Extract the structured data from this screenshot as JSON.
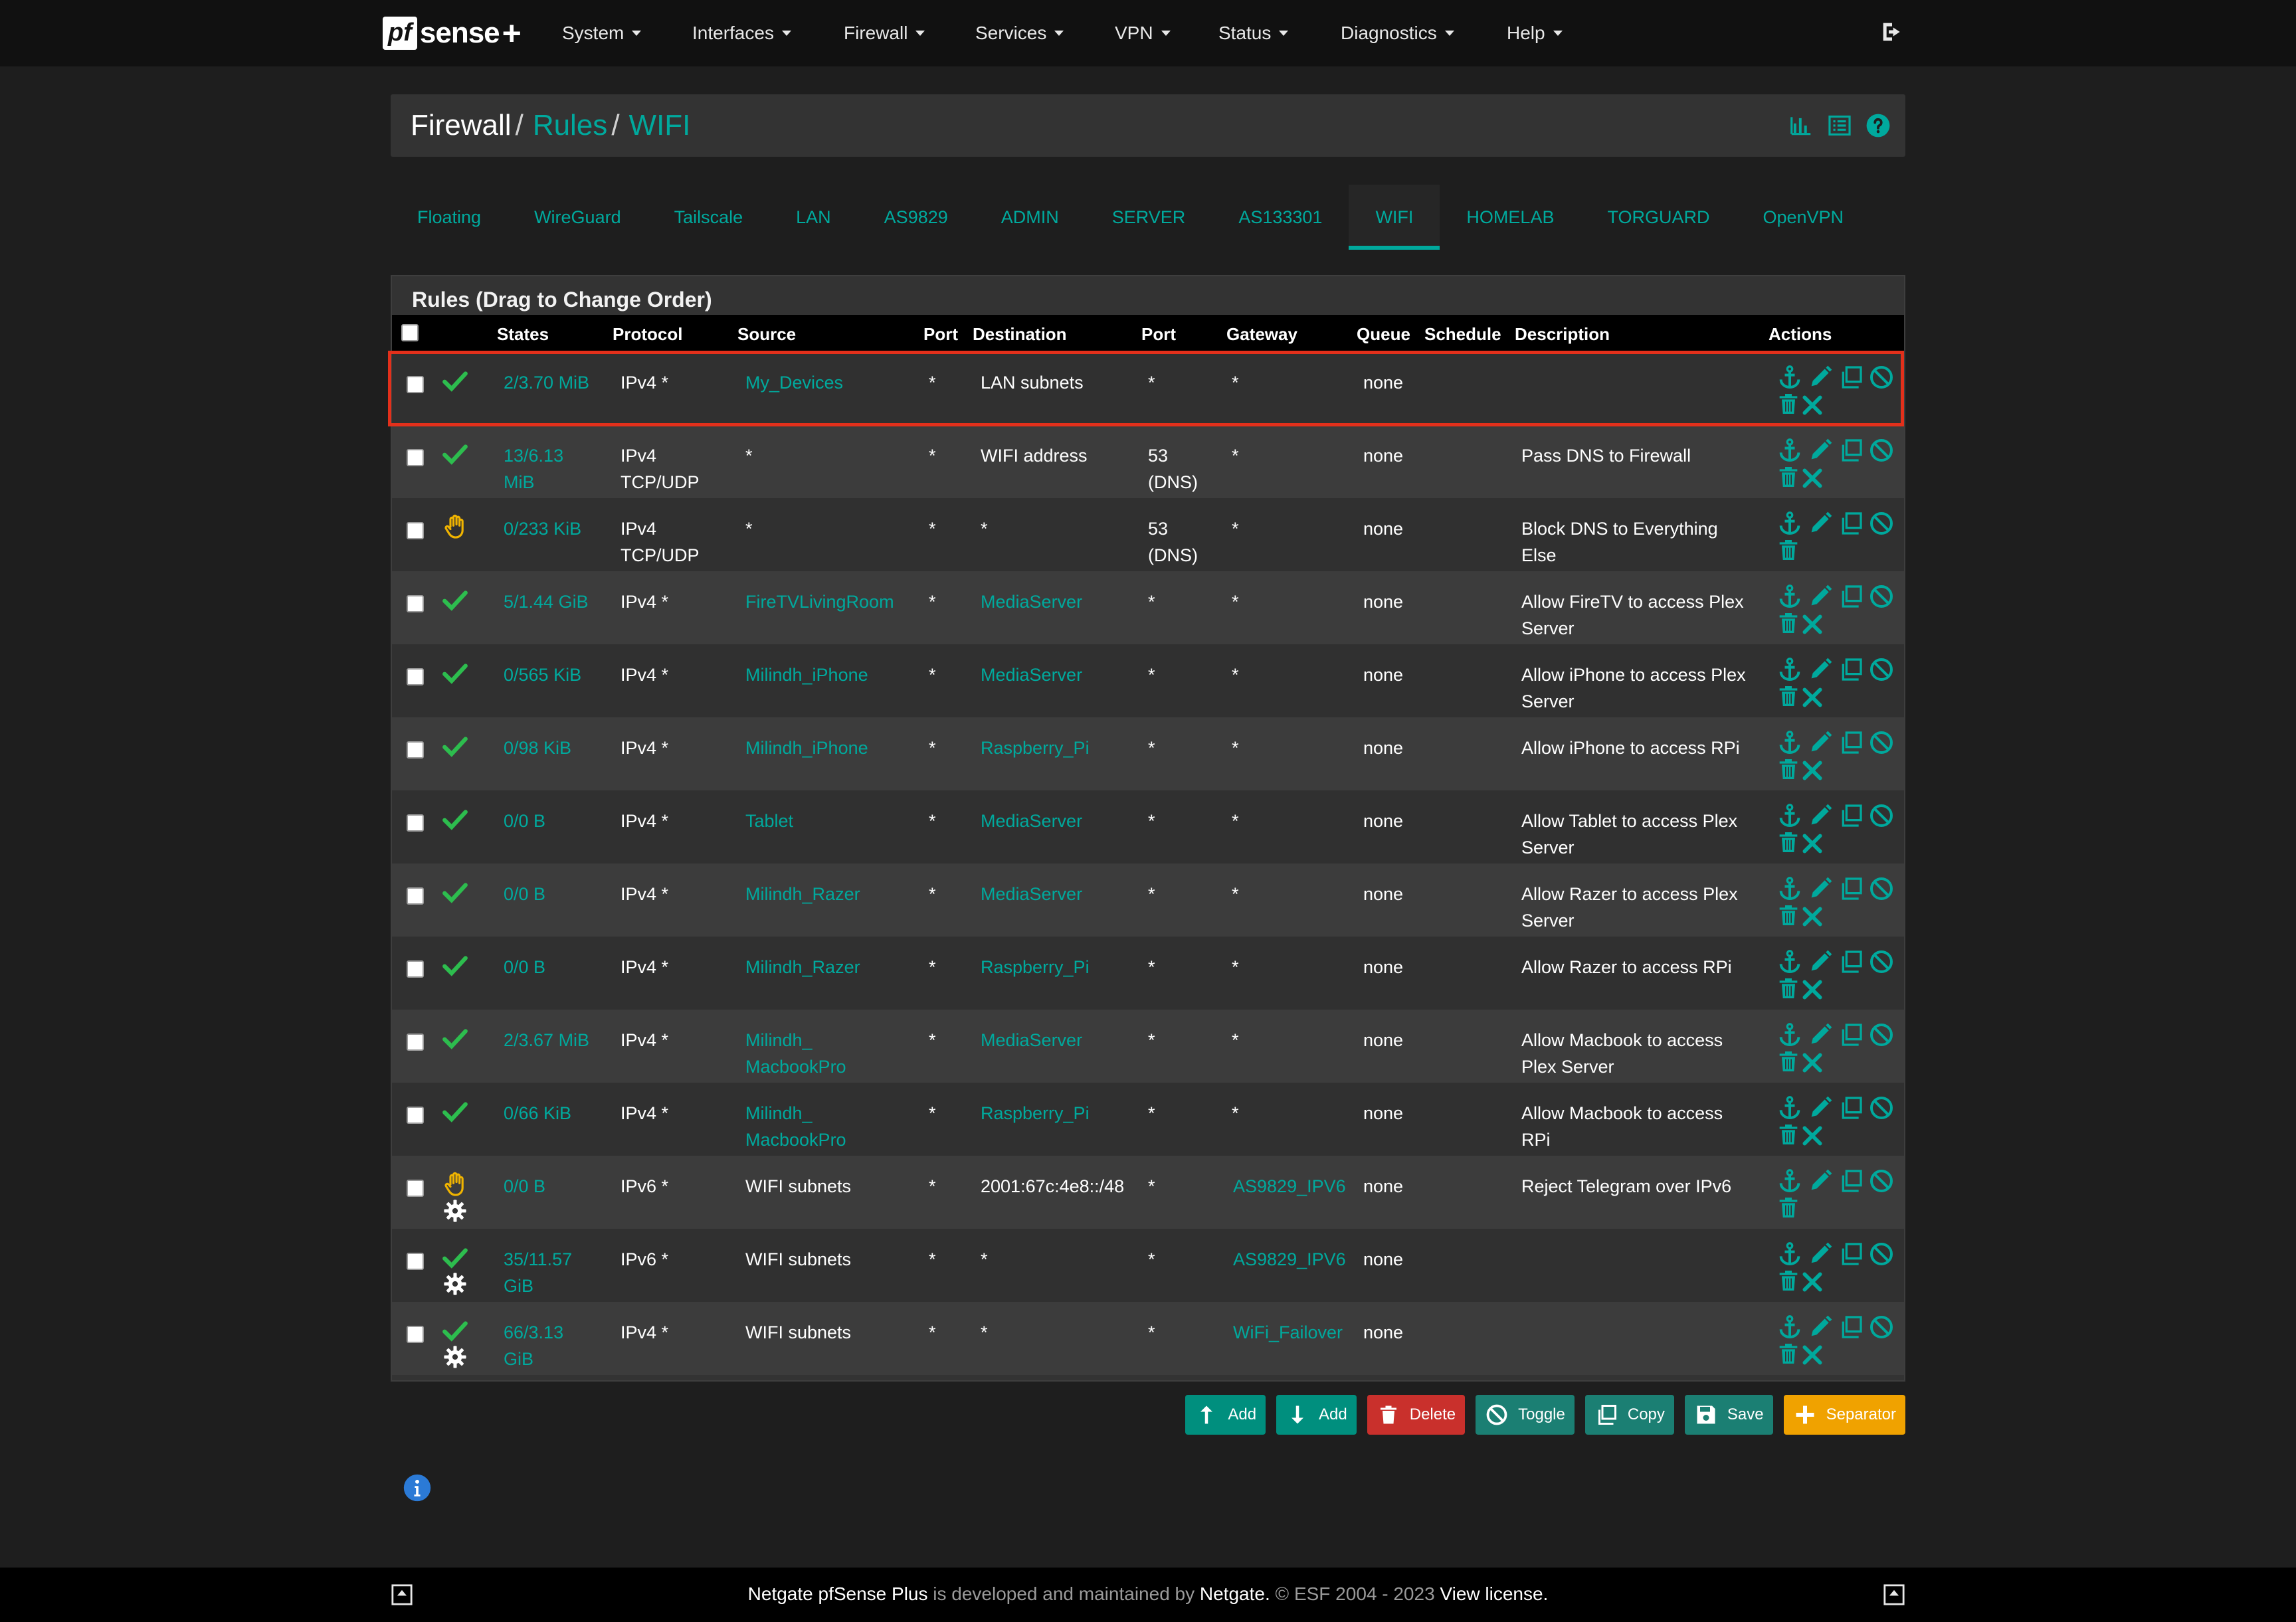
{
  "nav": {
    "brand_pf": "pf",
    "brand_sense": "sense",
    "brand_plus": "+",
    "menu": [
      "System",
      "Interfaces",
      "Firewall",
      "Services",
      "VPN",
      "Status",
      "Diagnostics",
      "Help"
    ]
  },
  "breadcrumb": {
    "part1": "Firewall",
    "sep1": "/",
    "part2": "Rules",
    "sep2": "/",
    "part3": "WIFI"
  },
  "tabs": [
    "Floating",
    "WireGuard",
    "Tailscale",
    "LAN",
    "AS9829",
    "ADMIN",
    "SERVER",
    "AS133301",
    "WIFI",
    "HOMELAB",
    "TORGUARD",
    "OpenVPN"
  ],
  "active_tab": "WIFI",
  "panel_title": "Rules (Drag to Change Order)",
  "columns": {
    "states": "States",
    "protocol": "Protocol",
    "source": "Source",
    "port": "Port",
    "destination": "Destination",
    "dport": "Port",
    "gateway": "Gateway",
    "queue": "Queue",
    "schedule": "Schedule",
    "description": "Description",
    "actions": "Actions"
  },
  "rules": [
    {
      "status": "pass",
      "gear": false,
      "states1": "2/3.70 MiB",
      "states2": "",
      "proto1": "IPv4 *",
      "proto2": "",
      "src1": "My_Devices",
      "src2": "",
      "src_link": true,
      "sport": "*",
      "dst": "LAN subnets",
      "dst_link": false,
      "dport1": "*",
      "dport2": "",
      "gw": "*",
      "gw_link": false,
      "queue": "none",
      "desc1": "",
      "desc2": "",
      "toggle_icon": true
    },
    {
      "status": "pass",
      "gear": false,
      "states1": "13/6.13",
      "states2": "MiB",
      "proto1": "IPv4",
      "proto2": "TCP/UDP",
      "src1": "*",
      "src2": "",
      "src_link": false,
      "sport": "*",
      "dst": "WIFI address",
      "dst_link": false,
      "dport1": "53",
      "dport2": "(DNS)",
      "gw": "*",
      "gw_link": false,
      "queue": "none",
      "desc1": "Pass DNS to Firewall",
      "desc2": "",
      "toggle_icon": true
    },
    {
      "status": "block",
      "gear": false,
      "states1": "0/233 KiB",
      "states2": "",
      "proto1": "IPv4",
      "proto2": "TCP/UDP",
      "src1": "*",
      "src2": "",
      "src_link": false,
      "sport": "*",
      "dst": "*",
      "dst_link": false,
      "dport1": "53",
      "dport2": "(DNS)",
      "gw": "*",
      "gw_link": false,
      "queue": "none",
      "desc1": "Block DNS to Everything",
      "desc2": "Else",
      "toggle_icon": false
    },
    {
      "status": "pass",
      "gear": false,
      "states1": "5/1.44 GiB",
      "states2": "",
      "proto1": "IPv4 *",
      "proto2": "",
      "src1": "FireTVLivingRoom",
      "src2": "",
      "src_link": true,
      "sport": "*",
      "dst": "MediaServer",
      "dst_link": true,
      "dport1": "*",
      "dport2": "",
      "gw": "*",
      "gw_link": false,
      "queue": "none",
      "desc1": "Allow FireTV to access Plex",
      "desc2": "Server",
      "toggle_icon": true
    },
    {
      "status": "pass",
      "gear": false,
      "states1": "0/565 KiB",
      "states2": "",
      "proto1": "IPv4 *",
      "proto2": "",
      "src1": "Milindh_iPhone",
      "src2": "",
      "src_link": true,
      "sport": "*",
      "dst": "MediaServer",
      "dst_link": true,
      "dport1": "*",
      "dport2": "",
      "gw": "*",
      "gw_link": false,
      "queue": "none",
      "desc1": "Allow iPhone to access Plex",
      "desc2": "Server",
      "toggle_icon": true
    },
    {
      "status": "pass",
      "gear": false,
      "states1": "0/98 KiB",
      "states2": "",
      "proto1": "IPv4 *",
      "proto2": "",
      "src1": "Milindh_iPhone",
      "src2": "",
      "src_link": true,
      "sport": "*",
      "dst": "Raspberry_Pi",
      "dst_link": true,
      "dport1": "*",
      "dport2": "",
      "gw": "*",
      "gw_link": false,
      "queue": "none",
      "desc1": "Allow iPhone to access RPi",
      "desc2": "",
      "toggle_icon": true
    },
    {
      "status": "pass",
      "gear": false,
      "states1": "0/0 B",
      "states2": "",
      "proto1": "IPv4 *",
      "proto2": "",
      "src1": "Tablet",
      "src2": "",
      "src_link": true,
      "sport": "*",
      "dst": "MediaServer",
      "dst_link": true,
      "dport1": "*",
      "dport2": "",
      "gw": "*",
      "gw_link": false,
      "queue": "none",
      "desc1": "Allow Tablet to access Plex",
      "desc2": "Server",
      "toggle_icon": true
    },
    {
      "status": "pass",
      "gear": false,
      "states1": "0/0 B",
      "states2": "",
      "proto1": "IPv4 *",
      "proto2": "",
      "src1": "Milindh_Razer",
      "src2": "",
      "src_link": true,
      "sport": "*",
      "dst": "MediaServer",
      "dst_link": true,
      "dport1": "*",
      "dport2": "",
      "gw": "*",
      "gw_link": false,
      "queue": "none",
      "desc1": "Allow Razer to access Plex",
      "desc2": "Server",
      "toggle_icon": true
    },
    {
      "status": "pass",
      "gear": false,
      "states1": "0/0 B",
      "states2": "",
      "proto1": "IPv4 *",
      "proto2": "",
      "src1": "Milindh_Razer",
      "src2": "",
      "src_link": true,
      "sport": "*",
      "dst": "Raspberry_Pi",
      "dst_link": true,
      "dport1": "*",
      "dport2": "",
      "gw": "*",
      "gw_link": false,
      "queue": "none",
      "desc1": "Allow Razer to access RPi",
      "desc2": "",
      "toggle_icon": true
    },
    {
      "status": "pass",
      "gear": false,
      "states1": "2/3.67 MiB",
      "states2": "",
      "proto1": "IPv4 *",
      "proto2": "",
      "src1": "Milindh_",
      "src2": "MacbookPro",
      "src_link": true,
      "sport": "*",
      "dst": "MediaServer",
      "dst_link": true,
      "dport1": "*",
      "dport2": "",
      "gw": "*",
      "gw_link": false,
      "queue": "none",
      "desc1": "Allow Macbook to access",
      "desc2": "Plex Server",
      "toggle_icon": true
    },
    {
      "status": "pass",
      "gear": false,
      "states1": "0/66 KiB",
      "states2": "",
      "proto1": "IPv4 *",
      "proto2": "",
      "src1": "Milindh_",
      "src2": "MacbookPro",
      "src_link": true,
      "sport": "*",
      "dst": "Raspberry_Pi",
      "dst_link": true,
      "dport1": "*",
      "dport2": "",
      "gw": "*",
      "gw_link": false,
      "queue": "none",
      "desc1": "Allow Macbook to access",
      "desc2": "RPi",
      "toggle_icon": true
    },
    {
      "status": "block",
      "gear": true,
      "states1": "0/0 B",
      "states2": "",
      "proto1": "IPv6 *",
      "proto2": "",
      "src1": "WIFI subnets",
      "src2": "",
      "src_link": false,
      "sport": "*",
      "dst": "2001:67c:4e8::/48",
      "dst_link": false,
      "dport1": "*",
      "dport2": "",
      "gw": "AS9829_IPV6",
      "gw_link": true,
      "queue": "none",
      "desc1": "Reject Telegram over IPv6",
      "desc2": "",
      "toggle_icon": false
    },
    {
      "status": "pass",
      "gear": true,
      "states1": "35/11.57",
      "states2": "GiB",
      "proto1": "IPv6 *",
      "proto2": "",
      "src1": "WIFI subnets",
      "src2": "",
      "src_link": false,
      "sport": "*",
      "dst": "*",
      "dst_link": false,
      "dport1": "*",
      "dport2": "",
      "gw": "AS9829_IPV6",
      "gw_link": true,
      "queue": "none",
      "desc1": "",
      "desc2": "",
      "toggle_icon": true
    },
    {
      "status": "pass",
      "gear": true,
      "states1": "66/3.13",
      "states2": "GiB",
      "proto1": "IPv4 *",
      "proto2": "",
      "src1": "WIFI subnets",
      "src2": "",
      "src_link": false,
      "sport": "*",
      "dst": "*",
      "dst_link": false,
      "dport1": "*",
      "dport2": "",
      "gw": "WiFi_Failover",
      "gw_link": true,
      "queue": "none",
      "desc1": "",
      "desc2": "",
      "toggle_icon": true
    }
  ],
  "buttons": {
    "add_top": "Add",
    "add_bottom": "Add",
    "delete": "Delete",
    "toggle": "Toggle",
    "copy": "Copy",
    "save": "Save",
    "separator": "Separator"
  },
  "footer": {
    "product": "Netgate pfSense Plus",
    "middle": " is developed and maintained by ",
    "company": "Netgate.",
    "copyright": " © ESF 2004 - 2023 ",
    "license": "View license."
  },
  "colors": {
    "accent": "#00a99d",
    "pass": "#2dbd4e",
    "block": "#f0b400",
    "danger": "#c9302c",
    "warning": "#f0a200",
    "highlight": "#e3301b"
  }
}
